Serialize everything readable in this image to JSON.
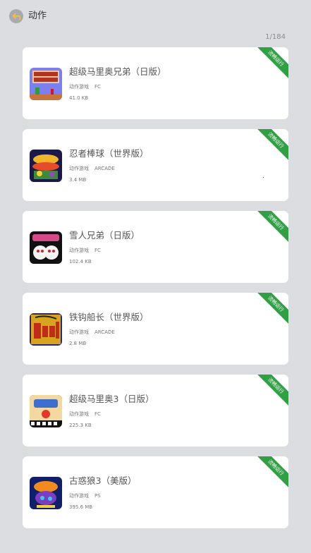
{
  "header": {
    "title": "动作",
    "counter": "1/184"
  },
  "colors": {
    "background": "#dcdde1",
    "card": "#ffffff",
    "badge": "#2fa044"
  },
  "games": [
    {
      "name": "超级马里奥兄弟（日版）",
      "genre": "动作游戏",
      "platform": "FC",
      "size": "41.0 KB",
      "badge": "流畅运行",
      "icon": "super-mario-bros-cover-icon"
    },
    {
      "name": "忍者棒球（世界版）",
      "genre": "动作游戏",
      "platform": "ARCADE",
      "size": "3.4 MB",
      "badge": "流畅运行",
      "icon": "ninja-baseball-cover-icon"
    },
    {
      "name": "雪人兄弟（日版）",
      "genre": "动作游戏",
      "platform": "FC",
      "size": "102.4 KB",
      "badge": "流畅运行",
      "icon": "snow-bros-cover-icon"
    },
    {
      "name": "铁钩船长（世界版）",
      "genre": "动作游戏",
      "platform": "ARCADE",
      "size": "2.8 MB",
      "badge": "流畅运行",
      "icon": "hook-cover-icon"
    },
    {
      "name": "超级马里奥3（日版）",
      "genre": "动作游戏",
      "platform": "FC",
      "size": "225.3 KB",
      "badge": "流畅运行",
      "icon": "super-mario-3-cover-icon"
    },
    {
      "name": "古惑狼3（美版）",
      "genre": "动作游戏",
      "platform": "PS",
      "size": "395.6 MB",
      "badge": "流畅运行",
      "icon": "crash-bandicoot-3-cover-icon"
    }
  ]
}
